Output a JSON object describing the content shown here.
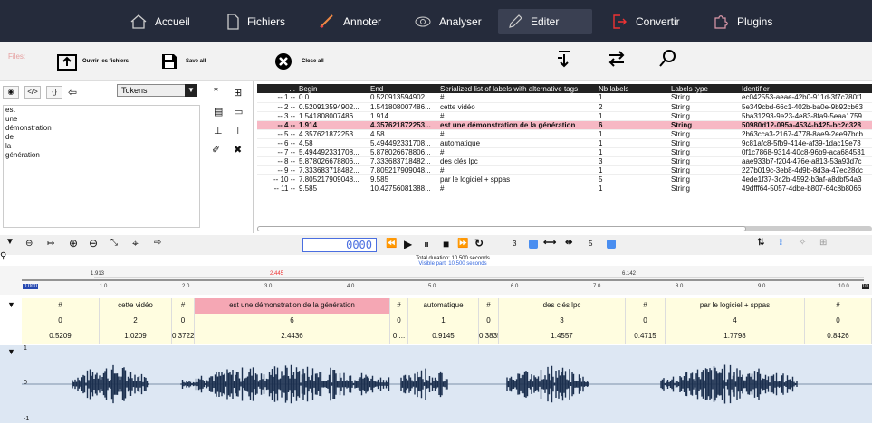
{
  "nav": {
    "items": [
      {
        "label": "Accueil",
        "icon": "home-icon"
      },
      {
        "label": "Fichiers",
        "icon": "file-icon"
      },
      {
        "label": "Annoter",
        "icon": "pen-icon"
      },
      {
        "label": "Analyser",
        "icon": "eye-icon"
      },
      {
        "label": "Editer",
        "icon": "pencil-icon"
      },
      {
        "label": "Convertir",
        "icon": "export-icon"
      },
      {
        "label": "Plugins",
        "icon": "puzzle-icon"
      }
    ],
    "active": "Editer"
  },
  "toolbar": {
    "files_label": "Files:",
    "open": "Ouvrir les fichiers",
    "save_all": "Save all",
    "close_all": "Close all"
  },
  "left": {
    "select_value": "Tokens",
    "tokens": [
      "est",
      "une",
      "démonstration",
      "de",
      "la",
      "génération"
    ]
  },
  "table": {
    "headers": [
      "...",
      "Begin",
      "End",
      "Serialized list of labels with alternative tags",
      "Nb labels",
      "Labels type",
      "Identifier"
    ],
    "rows": [
      {
        "n": "-- 1 --",
        "begin": "0.0",
        "end": "0.520913594902...",
        "label": "#",
        "nb": "1",
        "type": "String",
        "id": "ec042553-aeae-42b0-911d-3f7c780f1"
      },
      {
        "n": "-- 2 --",
        "begin": "0.520913594902...",
        "end": "1.541808007486...",
        "label": "cette vidéo",
        "nb": "2",
        "type": "String",
        "id": "5e349cbd-66c1-402b-ba0e-9b92cb63"
      },
      {
        "n": "-- 3 --",
        "begin": "1.541808007486...",
        "end": "1.914",
        "label": "#",
        "nb": "1",
        "type": "String",
        "id": "5ba31293-9e23-4e83-8fa9-5eaa1759"
      },
      {
        "n": "-- 4 --",
        "begin": "1.914",
        "end": "4.357621872253...",
        "label": "est une démonstration de la génération",
        "nb": "6",
        "type": "String",
        "id": "50980d12-095a-4534-b425-bc2c328"
      },
      {
        "n": "-- 5 --",
        "begin": "4.357621872253...",
        "end": "4.58",
        "label": "#",
        "nb": "1",
        "type": "String",
        "id": "2b63cca3-2167-4778-8ae9-2ee97bcb"
      },
      {
        "n": "-- 6 --",
        "begin": "4.58",
        "end": "5.494492331708...",
        "label": "automatique",
        "nb": "1",
        "type": "String",
        "id": "9c81afc8-5fb9-414e-af39-1dac19e73"
      },
      {
        "n": "-- 7 --",
        "begin": "5.494492331708...",
        "end": "5.878026678806...",
        "label": "#",
        "nb": "1",
        "type": "String",
        "id": "0f1c7868-9314-40c8-96b9-aca684531"
      },
      {
        "n": "-- 8 --",
        "begin": "5.878026678806...",
        "end": "7.333683718482...",
        "label": "des clés lpc",
        "nb": "3",
        "type": "String",
        "id": "aae933b7-f204-476e-a813-53a93d7c"
      },
      {
        "n": "-- 9 --",
        "begin": "7.333683718482...",
        "end": "7.805217909048...",
        "label": "#",
        "nb": "1",
        "type": "String",
        "id": "227b019c-3eb8-4d9b-8d3a-47ec28dc"
      },
      {
        "n": "-- 10 --",
        "begin": "7.805217909048...",
        "end": "9.585",
        "label": "par le logiciel + sppas",
        "nb": "5",
        "type": "String",
        "id": "4ede1f37-3c2b-4592-b3af-a8dbf54a3"
      },
      {
        "n": "-- 11 --",
        "begin": "9.585",
        "end": "10.42756081388...",
        "label": "#",
        "nb": "1",
        "type": "String",
        "id": "49dfff64-5057-4dbe-b807-64c8b8066"
      }
    ],
    "highlight_row": 3
  },
  "player": {
    "time": "0000",
    "level1": "3",
    "level2": "5",
    "total_duration": "Total duration: 10.500 seconds",
    "visible_part": "Visible part: 10.500 seconds"
  },
  "ruler": {
    "marks": [
      "1.913",
      "2.445",
      "6.142"
    ],
    "ticks": [
      "0.000",
      "1.0",
      "2.0",
      "3.0",
      "4.0",
      "5.0",
      "6.0",
      "7.0",
      "8.0",
      "9.0",
      "10.0",
      "10."
    ]
  },
  "annotation": {
    "labels": [
      "#",
      "cette vidéo",
      "#",
      "est une démonstration de la génération",
      "#",
      "automatique",
      "#",
      "des clés lpc",
      "#",
      "par le logiciel + sppas",
      "#"
    ],
    "counts": [
      "0",
      "2",
      "0",
      "6",
      "0",
      "1",
      "0",
      "3",
      "0",
      "4",
      "0"
    ],
    "durations": [
      "0.5209",
      "1.0209",
      "0.3722",
      "2.4436",
      "0....",
      "0.9145",
      "0.3835",
      "1.4557",
      "0.4715",
      "1.7798",
      "0.8426"
    ]
  },
  "wave": {
    "top": "1",
    "mid": "0",
    "bottom": "-1"
  }
}
